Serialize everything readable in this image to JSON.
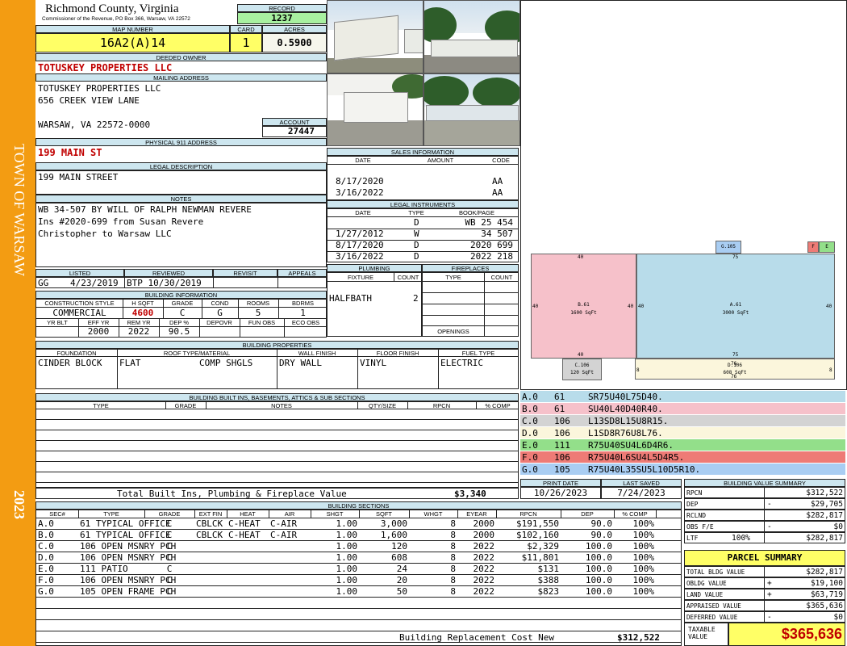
{
  "side": {
    "town": "TOWN OF WARSAW",
    "year": "2023"
  },
  "header": {
    "county": "Richmond County, Virginia",
    "commissioner": "Commissioner of the Revenue, PO Box 366, Warsaw, VA 22572",
    "record_label": "RECORD",
    "record": "1237",
    "map_label": "MAP NUMBER",
    "map_number": "16A2(A)14",
    "card_label": "CARD",
    "card": "1",
    "acres_label": "ACRES",
    "acres": "0.5900"
  },
  "owner": {
    "deeded_label": "DEEDED OWNER",
    "deeded": "TOTUSKEY PROPERTIES LLC",
    "mailing_label": "MAILING ADDRESS",
    "mail1": "TOTUSKEY PROPERTIES LLC",
    "mail2": "656 CREEK VIEW LANE",
    "mail3": "WARSAW, VA 22572-0000",
    "account_label": "ACCOUNT",
    "account": "27447",
    "physical_label": "PHYSICAL 911 ADDRESS",
    "physical": "199 MAIN ST",
    "legal_label": "LEGAL DESCRIPTION",
    "legal": "199 MAIN STREET",
    "notes_label": "NOTES",
    "notes1": "WB 34-507 BY WILL OF RALPH NEWMAN REVERE",
    "notes2": "Ins #2020-699 from Susan Revere",
    "notes3": "Christopher to Warsaw LLC"
  },
  "review": {
    "listed_label": "LISTED",
    "listed_by": "GG",
    "listed": "4/23/2019",
    "reviewed_label": "REVIEWED",
    "reviewed": "BTP 10/30/2019",
    "revisit_label": "REVISIT",
    "appeals_label": "APPEALS"
  },
  "building_info": {
    "title": "BUILDING INFORMATION",
    "h": [
      "CONSTRUCTION STYLE",
      "H SQFT",
      "GRADE",
      "COND",
      "ROOMS",
      "BDRMS"
    ],
    "v": [
      "COMMERCIAL",
      "4600",
      "C",
      "G",
      "5",
      "1"
    ],
    "h2": [
      "YR BLT",
      "EFF YR",
      "REM YR",
      "DEP %",
      "DEPOVR",
      "FUN OBS",
      "ECO OBS"
    ],
    "v2": [
      "",
      "2000",
      "2022",
      "90.5",
      "",
      "",
      ""
    ]
  },
  "sales": {
    "title": "SALES INFORMATION",
    "h": [
      "DATE",
      "AMOUNT",
      "CODE"
    ],
    "rows": [
      [
        "8/17/2020",
        "",
        "AA"
      ],
      [
        "3/16/2022",
        "",
        "AA"
      ]
    ]
  },
  "legal_instr": {
    "title": "LEGAL INSTRUMENTS",
    "h": [
      "DATE",
      "TYPE",
      "BOOK/PAGE"
    ],
    "rows": [
      [
        "",
        "D",
        "WB 25 454"
      ],
      [
        "1/27/2012",
        "W",
        "34 507"
      ],
      [
        "8/17/2020",
        "D",
        "2020 699"
      ],
      [
        "3/16/2022",
        "D",
        "2022 218"
      ]
    ]
  },
  "plumbing": {
    "title": "PLUMBING",
    "h": [
      "FIXTURE",
      "COUNT"
    ],
    "fixture": "HALFBATH",
    "count": "2"
  },
  "fireplaces": {
    "title": "FIREPLACES",
    "h": [
      "TYPE",
      "COUNT"
    ],
    "openings": "OPENINGS"
  },
  "props": {
    "title": "BUILDING PROPERTIES",
    "h": [
      "FOUNDATION",
      "ROOF TYPE/MATERIAL",
      "WALL FINISH",
      "FLOOR FINISH",
      "FUEL TYPE"
    ],
    "foundation": "CINDER BLOCK",
    "roof_type": "FLAT",
    "roof_mat": "COMP SHGLS",
    "wall": "DRY WALL",
    "floor": "VINYL",
    "fuel": "ELECTRIC"
  },
  "builtins": {
    "title": "BUILDING BUILT INS, BASEMENTS, ATTICS & SUB SECTIONS",
    "h": [
      "TYPE",
      "GRADE",
      "NOTES",
      "QTY/SIZE",
      "RPCN",
      "% COMP"
    ],
    "total_label": "Total Built Ins, Plumbing & Fireplace Value",
    "total": "$3,340"
  },
  "dates": {
    "print_label": "PRINT DATE",
    "print": "10/26/2023",
    "saved_label": "LAST SAVED",
    "saved": "7/24/2023"
  },
  "sketch": {
    "A": {
      "code": "A.61",
      "area": "3000 SqFt"
    },
    "B": {
      "code": "B.61",
      "area": "1600 SqFt"
    },
    "C": {
      "code": "C.106",
      "area": "120 SqFt"
    },
    "D": {
      "code": "D.106",
      "area": "608 SqFt"
    },
    "G": "G.105",
    "F": "F",
    "E": "E",
    "dims": {
      "d40": "40",
      "d75": "75",
      "d76": "76",
      "d8": "8"
    }
  },
  "legend": [
    {
      "sec": "A.0",
      "code": "61",
      "vec": "SR75U40L75D40.",
      "color": "#b8dcea"
    },
    {
      "sec": "B.0",
      "code": "61",
      "vec": "SU40L40D40R40.",
      "color": "#f6c1ca"
    },
    {
      "sec": "C.0",
      "code": "106",
      "vec": "L13SD8L15U8R15.",
      "color": "#d3d3d3"
    },
    {
      "sec": "D.0",
      "code": "106",
      "vec": "L1SD8R76U8L76.",
      "color": "#fbf6dc"
    },
    {
      "sec": "E.0",
      "code": "111",
      "vec": "R75U40SU4L6D4R6.",
      "color": "#93df8a"
    },
    {
      "sec": "F.0",
      "code": "106",
      "vec": "R75U40L6SU4L5D4R5.",
      "color": "#ee7b76"
    },
    {
      "sec": "G.0",
      "code": "105",
      "vec": "R75U40L35SU5L10D5R10.",
      "color": "#a9cdf2"
    }
  ],
  "sections": {
    "title": "BUILDING SECTIONS",
    "h": [
      "SEC#",
      "TYPE",
      "GRADE",
      "EXT FIN",
      "HEAT",
      "AIR",
      "SHGT",
      "SQFT",
      "WHGT",
      "EYEAR",
      "RPCN",
      "DEP",
      "% COMP"
    ],
    "rows": [
      [
        "A.0",
        "61 TYPICAL OFFICE",
        "C",
        "CBLCK",
        "C-HEAT",
        "C-AIR",
        "1.00",
        "3,000",
        "8",
        "2000",
        "$191,550",
        "90.0",
        "100%"
      ],
      [
        "B.0",
        "61 TYPICAL OFFICE",
        "C",
        "CBLCK",
        "C-HEAT",
        "C-AIR",
        "1.00",
        "1,600",
        "8",
        "2000",
        "$102,160",
        "90.0",
        "100%"
      ],
      [
        "C.0",
        "106 OPEN MSNRY PCH",
        "C",
        "",
        "",
        "",
        "1.00",
        "120",
        "8",
        "2022",
        "$2,329",
        "100.0",
        "100%"
      ],
      [
        "D.0",
        "106 OPEN MSNRY PCH",
        "C",
        "",
        "",
        "",
        "1.00",
        "608",
        "8",
        "2022",
        "$11,801",
        "100.0",
        "100%"
      ],
      [
        "E.0",
        "111 PATIO",
        "C",
        "",
        "",
        "",
        "1.00",
        "24",
        "8",
        "2022",
        "$131",
        "100.0",
        "100%"
      ],
      [
        "F.0",
        "106 OPEN MSNRY PCH",
        "C",
        "",
        "",
        "",
        "1.00",
        "20",
        "8",
        "2022",
        "$388",
        "100.0",
        "100%"
      ],
      [
        "G.0",
        "105 OPEN FRAME PCH",
        "C",
        "",
        "",
        "",
        "1.00",
        "50",
        "8",
        "2022",
        "$823",
        "100.0",
        "100%"
      ]
    ],
    "brcn_label": "Building Replacement Cost New",
    "brcn": "$312,522"
  },
  "bvs": {
    "title": "BUILDING VALUE SUMMARY",
    "rows": [
      {
        "label": "RPCN",
        "sign": "",
        "val": "$312,522"
      },
      {
        "label": "DEP",
        "sign": "-",
        "val": "$29,705"
      },
      {
        "label": "RCLND",
        "sign": "",
        "val": "$282,817"
      },
      {
        "label": "OBS F/E",
        "sign": "-",
        "val": "$0"
      },
      {
        "label": "LTF",
        "pct": "100%",
        "sign": "",
        "val": "$282,817"
      }
    ]
  },
  "parcel": {
    "title": "PARCEL SUMMARY",
    "rows": [
      {
        "label": "TOTAL BLDG VALUE",
        "sign": "",
        "val": "$282,817"
      },
      {
        "label": "OBLDG VALUE",
        "sign": "+",
        "val": "$19,100"
      },
      {
        "label": "LAND VALUE",
        "sign": "+",
        "val": "$63,719"
      },
      {
        "label": "APPRAISED VALUE",
        "sign": "",
        "val": "$365,636"
      },
      {
        "label": "DEFERRED VALUE",
        "sign": "-",
        "val": "$0"
      }
    ],
    "taxable_label": "TAXABLE VALUE",
    "taxable": "$365,636"
  },
  "colors": {
    "accent": "#f39c12",
    "header": "#cde6ef",
    "highlight": "#ffff66",
    "record": "#a8f0a0",
    "emph": "#c00000"
  }
}
